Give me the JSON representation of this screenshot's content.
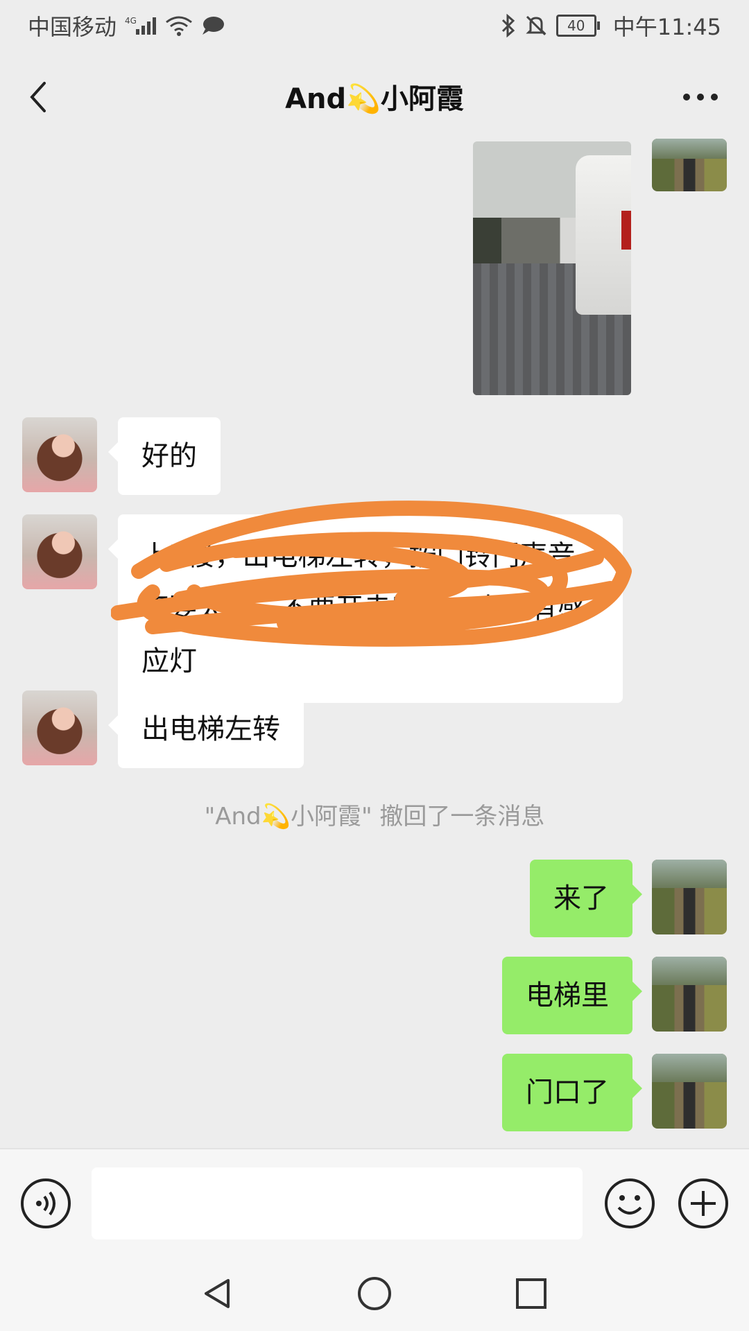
{
  "status_bar": {
    "carrier": "中国移动",
    "network": "4G",
    "battery": "40",
    "time": "中午11:45"
  },
  "header": {
    "title": "And💫小阿霞",
    "back_icon": "chevron-left-icon",
    "more_icon": "more-dots-icon"
  },
  "messages": [
    {
      "side": "right",
      "type": "image",
      "description_icon": "photo"
    },
    {
      "side": "left",
      "type": "text",
      "text": "好的"
    },
    {
      "side": "left",
      "type": "text",
      "text": "上7楼，出电梯左转，按门铃门声音不要太大，不要开走廊灯，走廊有感应灯",
      "obscured": true
    },
    {
      "side": "left",
      "type": "text",
      "text": "出电梯左转"
    },
    {
      "side": "right",
      "type": "text",
      "text": "来了"
    },
    {
      "side": "right",
      "type": "text",
      "text": "电梯里"
    },
    {
      "side": "right",
      "type": "text",
      "text": "门口了"
    }
  ],
  "system_message": "\"And💫小阿霞\" 撤回了一条消息",
  "input_bar": {
    "placeholder": "",
    "voice_icon": "voice-icon",
    "emoji_icon": "emoji-icon",
    "plus_icon": "plus-icon"
  },
  "nav_bar": {
    "back_icon": "nav-back-icon",
    "home_icon": "nav-home-icon",
    "recents_icon": "nav-recents-icon"
  },
  "colors": {
    "background": "#ededed",
    "bubble_left": "#ffffff",
    "bubble_right": "#95ec69",
    "scribble": "#f08a3c"
  }
}
